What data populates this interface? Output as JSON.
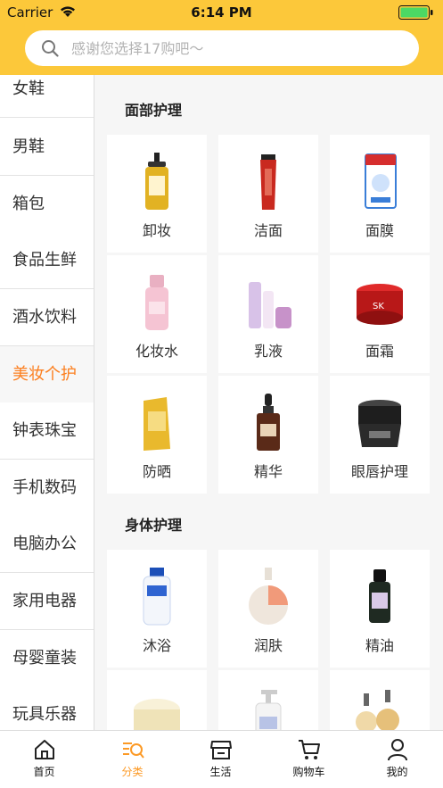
{
  "status_bar": {
    "carrier": "Carrier",
    "time": "6:14 PM"
  },
  "search": {
    "placeholder": "感谢您选择17购吧～"
  },
  "sidebar": {
    "items": [
      {
        "label": "女鞋"
      },
      {
        "label": "男鞋"
      },
      {
        "label": "箱包"
      },
      {
        "label": "食品生鲜"
      },
      {
        "label": "酒水饮料"
      },
      {
        "label": "美妆个护"
      },
      {
        "label": "钟表珠宝"
      },
      {
        "label": "手机数码"
      },
      {
        "label": "电脑办公"
      },
      {
        "label": "家用电器"
      },
      {
        "label": "母婴童装"
      },
      {
        "label": "玩具乐器"
      }
    ],
    "active_label": "美妆个护"
  },
  "sections": [
    {
      "title": "面部护理",
      "items": [
        {
          "label": "卸妆",
          "icon": "cleansing-oil-bottle"
        },
        {
          "label": "洁面",
          "icon": "face-wash-tube"
        },
        {
          "label": "面膜",
          "icon": "face-mask-pack"
        },
        {
          "label": "化妆水",
          "icon": "toner-bottle"
        },
        {
          "label": "乳液",
          "icon": "lotion-set"
        },
        {
          "label": "面霜",
          "icon": "cream-jar"
        },
        {
          "label": "防晒",
          "icon": "sunscreen-bottle"
        },
        {
          "label": "精华",
          "icon": "serum-dropper-bottle"
        },
        {
          "label": "眼唇护理",
          "icon": "eye-cream-jar"
        }
      ]
    },
    {
      "title": "身体护理",
      "items": [
        {
          "label": "沐浴",
          "icon": "body-wash-bottle"
        },
        {
          "label": "润肤",
          "icon": "body-lotion-bottle"
        },
        {
          "label": "精油",
          "icon": "essential-oil-bottle"
        },
        {
          "label": "",
          "icon": "body-cream-jar"
        },
        {
          "label": "",
          "icon": "pump-bottle"
        },
        {
          "label": "",
          "icon": "perfume-bottles"
        }
      ]
    }
  ],
  "tabbar": {
    "tabs": [
      {
        "label": "首页",
        "icon": "home-icon"
      },
      {
        "label": "分类",
        "icon": "category-search-icon"
      },
      {
        "label": "生活",
        "icon": "shop-icon"
      },
      {
        "label": "购物车",
        "icon": "cart-icon"
      },
      {
        "label": "我的",
        "icon": "user-icon"
      }
    ],
    "active_label": "分类"
  },
  "colors": {
    "brand_yellow": "#fcc83a",
    "active_orange": "#fc7f1f",
    "battery_green": "#4cd964"
  }
}
